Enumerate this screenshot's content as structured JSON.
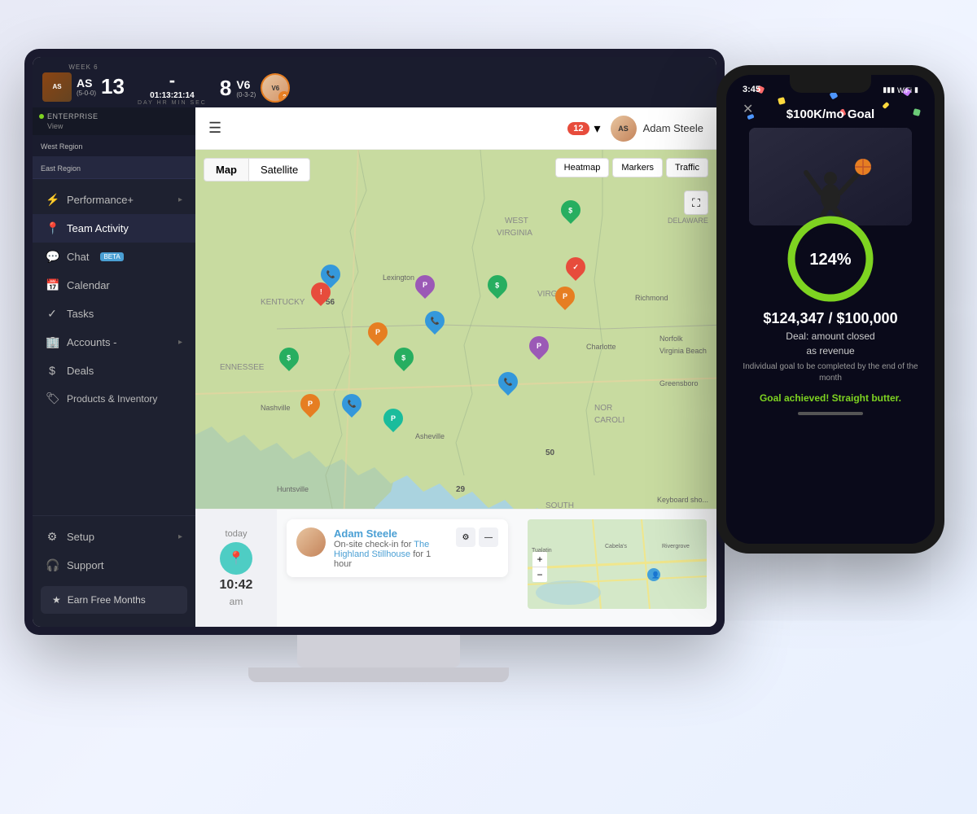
{
  "sports_banner": {
    "week_label": "WEEK 6",
    "team_left": {
      "initials": "AS",
      "record": "(5-0-0)",
      "score": "13"
    },
    "team_right": {
      "initials": "V6",
      "record": "(0-3-2)",
      "score": "8"
    },
    "score_separator": "-",
    "timer": {
      "value": "01:13:21:14",
      "labels": "DAY  HR   MIN  SEC"
    }
  },
  "header": {
    "notification_count": "12",
    "user_name": "Adam Steele",
    "chevron": "▾"
  },
  "sidebar": {
    "enterprise_label": "Enterprise",
    "view_label": "View",
    "regions": [
      {
        "label": "West",
        "sublabel": "Region"
      },
      {
        "label": "East",
        "sublabel": "Region"
      }
    ],
    "nav_items": [
      {
        "icon": "⚡",
        "label": "Performance+",
        "has_arrow": true
      },
      {
        "icon": "📍",
        "label": "Team Activity",
        "active": true
      },
      {
        "icon": "💬",
        "label": "Chat",
        "badge": "BETA"
      },
      {
        "icon": "📅",
        "label": "Calendar"
      },
      {
        "icon": "✓",
        "label": "Tasks"
      },
      {
        "icon": "🏢",
        "label": "Accounts -",
        "has_arrow": true
      },
      {
        "icon": "$",
        "label": "Deals"
      },
      {
        "icon": "🏷",
        "label": "Products & Inventory"
      }
    ],
    "bottom_items": [
      {
        "icon": "⚙",
        "label": "Setup",
        "has_arrow": true
      },
      {
        "icon": "🎧",
        "label": "Support"
      }
    ],
    "earn_label": "★  Earn Free Months"
  },
  "map": {
    "view_buttons": [
      "Map",
      "Satellite"
    ],
    "active_view": "Map",
    "layer_buttons": [
      "Heatmap",
      "Markers",
      "Traffic"
    ],
    "expand_icon": "⛶",
    "keyboard_shortcut": "Keyboard sho..."
  },
  "activity": {
    "time_label": "today",
    "time_value": "10:42",
    "time_ampm": "am",
    "card": {
      "user_name": "Adam Steele",
      "description": "On-site check-in for ",
      "location": "The Highland Stillhouse",
      "duration": " for 1 hour"
    }
  },
  "phone": {
    "status_bar": {
      "time": "3:45",
      "signal": "▮▮▮",
      "wifi": "WiFi",
      "battery": "🔋"
    },
    "close_icon": "✕",
    "goal_title": "$100K/mo Goal",
    "progress_pct": "124%",
    "goal_amount": "$124,347 / $100,000",
    "goal_deal_label": "Deal: amount closed",
    "goal_deal_sub": "as revenue",
    "goal_subtext": "Individual goal to be completed by the end of the month",
    "goal_achieved": "Goal achieved! Straight butter."
  },
  "colors": {
    "sidebar_bg": "#1e2130",
    "sidebar_active": "#252840",
    "header_bg": "#ffffff",
    "accent_blue": "#4a9fd4",
    "accent_green": "#7ed321",
    "accent_teal": "#4ecdc4",
    "pin_green": "#27ae60",
    "pin_blue": "#3498db",
    "pin_orange": "#e67e22",
    "pin_red": "#e74c3c",
    "pin_purple": "#9b59b6",
    "earn_bg": "#2a2d3e"
  }
}
